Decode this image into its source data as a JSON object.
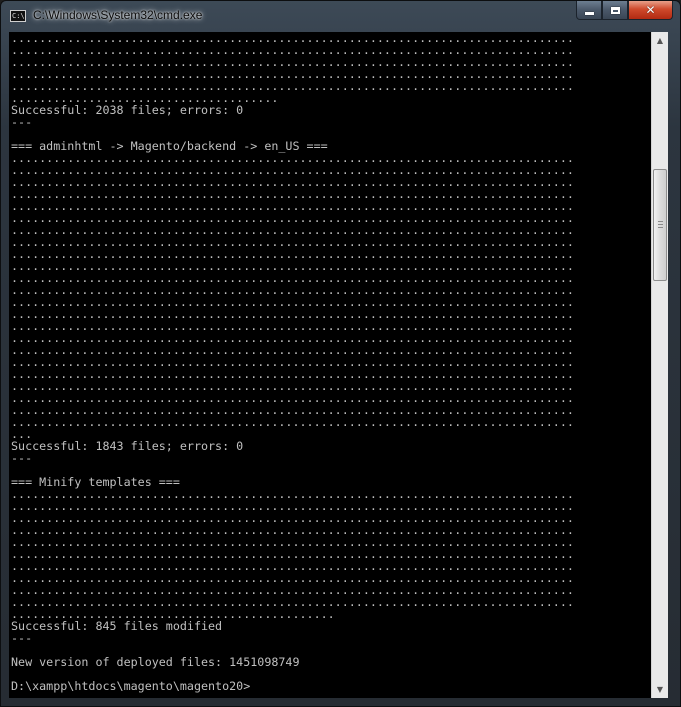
{
  "window": {
    "title": "C:\\Windows\\System32\\cmd.exe",
    "icon_text": "C:\\"
  },
  "controls": {
    "minimize": "minimize-icon",
    "maximize": "maximize-icon",
    "close": "close-icon"
  },
  "console": {
    "lines": [
      "................................................................................",
      "................................................................................",
      "................................................................................",
      "................................................................................",
      "................................................................................",
      "......................................",
      "Successful: 2038 files; errors: 0",
      "---",
      "",
      "=== adminhtml -> Magento/backend -> en_US ===",
      "................................................................................",
      "................................................................................",
      "................................................................................",
      "................................................................................",
      "................................................................................",
      "................................................................................",
      "................................................................................",
      "................................................................................",
      "................................................................................",
      "................................................................................",
      "................................................................................",
      "................................................................................",
      "................................................................................",
      "................................................................................",
      "................................................................................",
      "................................................................................",
      "................................................................................",
      "................................................................................",
      "................................................................................",
      "................................................................................",
      "................................................................................",
      "................................................................................",
      "................................................................................",
      "...",
      "Successful: 1843 files; errors: 0",
      "---",
      "",
      "=== Minify templates ===",
      "................................................................................",
      "................................................................................",
      "................................................................................",
      "................................................................................",
      "................................................................................",
      "................................................................................",
      "................................................................................",
      "................................................................................",
      "................................................................................",
      "................................................................................",
      "..............................................",
      "Successful: 845 files modified",
      "---",
      "",
      "New version of deployed files: 1451098749",
      "",
      "D:\\xampp\\htdocs\\magento\\magento20>"
    ]
  },
  "scrollbar": {
    "up_icon": "scroll-up-arrow-icon",
    "down_icon": "scroll-down-arrow-icon"
  }
}
